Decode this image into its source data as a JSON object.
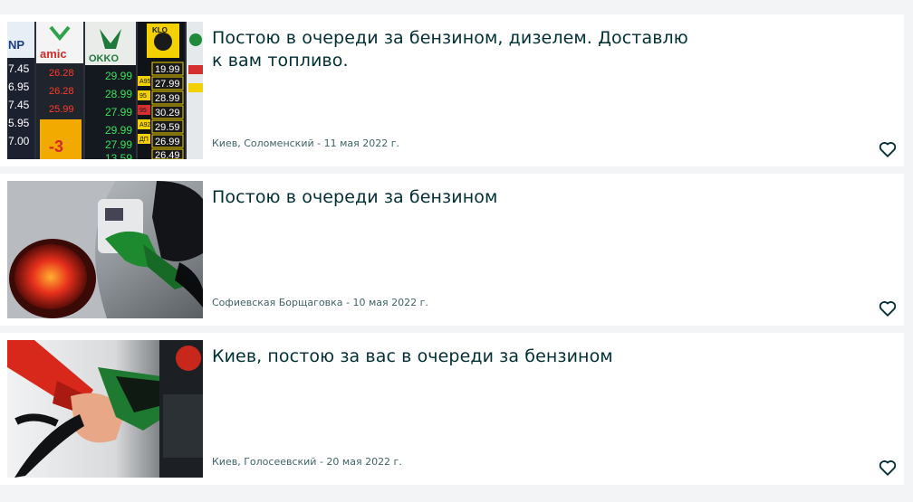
{
  "listings": [
    {
      "title": "Постою в очереди за бензином, дизелем. Доставлю к вам топливо.",
      "meta": "Киев, Соломенский - 11 мая 2022 г.",
      "image": "gas-station-price-board",
      "price_board": {
        "brands": [
          "NP",
          "amic",
          "OKKO",
          "KLO"
        ],
        "col1": [
          "7.45",
          "6.95",
          "7.45",
          "5.95",
          "7.00"
        ],
        "col2": [
          "26.28",
          "26.28",
          "25.99"
        ],
        "promo": "-3",
        "col3": [
          "29.99",
          "28.99",
          "27.99",
          "29.99",
          "27.99",
          "13.59"
        ],
        "col4": [
          "19.99",
          "27.99",
          "28.99",
          "30.29",
          "29.59",
          "26.99",
          "26.49"
        ],
        "col4_labels": [
          "",
          "A95",
          "95",
          "95",
          "A92",
          "ДП",
          ""
        ]
      }
    },
    {
      "title": "Постою в очереди за бензином",
      "meta": "Софиевская Борщаговка - 10 мая 2022 г.",
      "image": "fuel-nozzle-in-car"
    },
    {
      "title": "Киев, постою за вас в очереди за бензином",
      "meta": "Киев, Голосеевский - 20 мая 2022 г.",
      "image": "hand-holding-fuel-nozzle"
    }
  ]
}
